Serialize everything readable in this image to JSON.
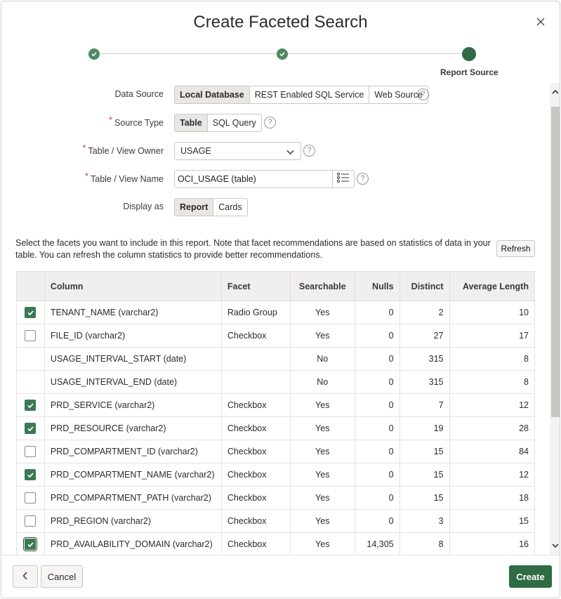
{
  "dialog": {
    "title": "Create Faceted Search",
    "close_icon": "close-icon"
  },
  "wizard": {
    "steps": [
      {
        "label": "",
        "state": "complete"
      },
      {
        "label": "",
        "state": "complete"
      },
      {
        "label": "Report Source",
        "state": "current"
      }
    ]
  },
  "form": {
    "data_source": {
      "label": "Data Source",
      "options": [
        "Local Database",
        "REST Enabled SQL Service",
        "Web Source"
      ],
      "selected": "Local Database"
    },
    "source_type": {
      "label": "Source Type",
      "required": true,
      "options": [
        "Table",
        "SQL Query"
      ],
      "selected": "Table"
    },
    "table_owner": {
      "label": "Table / View Owner",
      "required": true,
      "value": "USAGE"
    },
    "table_name": {
      "label": "Table / View Name",
      "required": true,
      "value": "OCI_USAGE (table)"
    },
    "display_as": {
      "label": "Display as",
      "options": [
        "Report",
        "Cards"
      ],
      "selected": "Report"
    },
    "help_glyph": "?"
  },
  "facets": {
    "info": "Select the facets you want to include in this report. Note that facet recommendations are based on statistics of data in your table. You can refresh the column statistics to provide better recommendations.",
    "refresh_label": "Refresh",
    "headers": [
      "",
      "Column",
      "Facet",
      "Searchable",
      "Nulls",
      "Distinct",
      "Average Length"
    ],
    "rows": [
      {
        "checkbox": "checked",
        "column": "TENANT_NAME (varchar2)",
        "facet": "Radio Group",
        "searchable": "Yes",
        "nulls": "0",
        "distinct": "2",
        "avg_length": "10"
      },
      {
        "checkbox": "unchecked",
        "column": "FILE_ID (varchar2)",
        "facet": "Checkbox",
        "searchable": "Yes",
        "nulls": "0",
        "distinct": "27",
        "avg_length": "17"
      },
      {
        "checkbox": "none",
        "column": "USAGE_INTERVAL_START (date)",
        "facet": "",
        "searchable": "No",
        "nulls": "0",
        "distinct": "315",
        "avg_length": "8"
      },
      {
        "checkbox": "none",
        "column": "USAGE_INTERVAL_END (date)",
        "facet": "",
        "searchable": "No",
        "nulls": "0",
        "distinct": "315",
        "avg_length": "8"
      },
      {
        "checkbox": "checked",
        "column": "PRD_SERVICE (varchar2)",
        "facet": "Checkbox",
        "searchable": "Yes",
        "nulls": "0",
        "distinct": "7",
        "avg_length": "12"
      },
      {
        "checkbox": "checked",
        "column": "PRD_RESOURCE (varchar2)",
        "facet": "Checkbox",
        "searchable": "Yes",
        "nulls": "0",
        "distinct": "19",
        "avg_length": "28"
      },
      {
        "checkbox": "unchecked",
        "column": "PRD_COMPARTMENT_ID (varchar2)",
        "facet": "Checkbox",
        "searchable": "Yes",
        "nulls": "0",
        "distinct": "15",
        "avg_length": "84"
      },
      {
        "checkbox": "checked",
        "column": "PRD_COMPARTMENT_NAME (varchar2)",
        "facet": "Checkbox",
        "searchable": "Yes",
        "nulls": "0",
        "distinct": "15",
        "avg_length": "12"
      },
      {
        "checkbox": "unchecked",
        "column": "PRD_COMPARTMENT_PATH (varchar2)",
        "facet": "Checkbox",
        "searchable": "Yes",
        "nulls": "0",
        "distinct": "15",
        "avg_length": "18"
      },
      {
        "checkbox": "unchecked",
        "column": "PRD_REGION (varchar2)",
        "facet": "Checkbox",
        "searchable": "Yes",
        "nulls": "0",
        "distinct": "3",
        "avg_length": "15"
      },
      {
        "checkbox": "checked",
        "column": "PRD_AVAILABILITY_DOMAIN (varchar2)",
        "facet": "Checkbox",
        "searchable": "Yes",
        "nulls": "14,305",
        "distinct": "8",
        "avg_length": "16"
      }
    ]
  },
  "footer": {
    "back_icon": "chevron-left-icon",
    "cancel_label": "Cancel",
    "create_label": "Create"
  },
  "colors": {
    "accent": "#2f6b45",
    "checkbox_checked": "#3a7a54",
    "required": "#c74634"
  }
}
